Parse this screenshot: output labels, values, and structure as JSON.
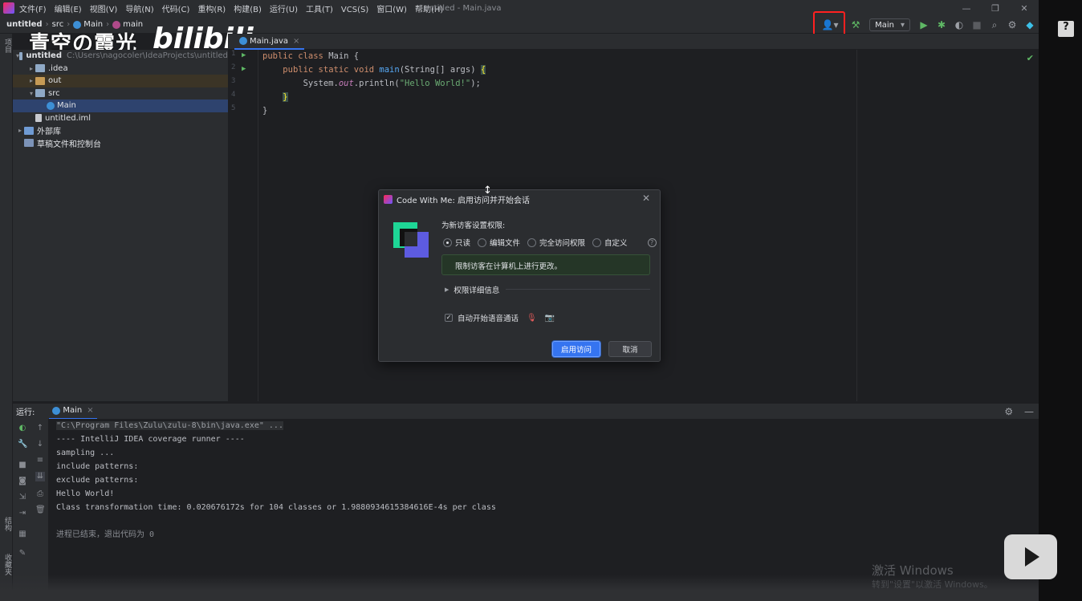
{
  "titlebar": {
    "menus": [
      "文件(F)",
      "编辑(E)",
      "视图(V)",
      "导航(N)",
      "代码(C)",
      "重构(R)",
      "构建(B)",
      "运行(U)",
      "工具(T)",
      "VCS(S)",
      "窗口(W)",
      "帮助(H)"
    ],
    "window_title": "untitled - Main.java",
    "controls": [
      "—",
      "❐",
      "✕"
    ]
  },
  "navbar": {
    "project": "untitled",
    "crumb_src": "src",
    "crumb_class": "Main",
    "crumb_method": "main",
    "run_config": "Main"
  },
  "watermark": {
    "text": "青空の霞光",
    "brand": "bilibili"
  },
  "left_strip": {
    "project_label": "项目",
    "structure_label": "结构",
    "bookmarks_label": "收藏夹"
  },
  "project_tree": [
    {
      "label": "untitled",
      "path": "C:\\Users\\nagocoler\\IdeaProjects\\untitled",
      "indent": 0,
      "arrow": "▾",
      "icon": "folder"
    },
    {
      "label": ".idea",
      "indent": 1,
      "arrow": "▸",
      "icon": "folder"
    },
    {
      "label": "out",
      "indent": 1,
      "arrow": "▸",
      "icon": "folder-orange"
    },
    {
      "label": "src",
      "indent": 1,
      "arrow": "▾",
      "icon": "folder"
    },
    {
      "label": "Main",
      "indent": 2,
      "arrow": "",
      "icon": "class"
    },
    {
      "label": "untitled.iml",
      "indent": 1,
      "arrow": "",
      "icon": "file"
    },
    {
      "label": "外部库",
      "indent": 0,
      "arrow": "▸",
      "icon": "library"
    },
    {
      "label": "草稿文件和控制台",
      "indent": 0,
      "arrow": "",
      "icon": "scratch"
    }
  ],
  "editor": {
    "tab": "Main.java",
    "line_numbers": [
      "1",
      "2",
      "3",
      "4",
      "5"
    ],
    "lines": [
      [
        [
          "kw",
          "public class "
        ],
        [
          "",
          "Main {"
        ]
      ],
      [
        [
          "",
          "    "
        ],
        [
          "kw",
          "public static void "
        ],
        [
          "fn",
          "main"
        ],
        [
          "",
          "(String[] args) "
        ],
        [
          "brace",
          "{"
        ]
      ],
      [
        [
          "",
          "        System."
        ],
        [
          "it",
          "out"
        ],
        [
          "",
          ".println("
        ],
        [
          "st",
          "\"Hello World!\""
        ],
        [
          "",
          ");"
        ]
      ],
      [
        [
          "",
          "    "
        ],
        [
          "brace",
          "}"
        ]
      ],
      [
        [
          "",
          "}"
        ]
      ]
    ]
  },
  "run_panel": {
    "label": "运行:",
    "tab": "Main",
    "console": [
      {
        "text": "\"C:\\Program Files\\Zulu\\zulu-8\\bin\\java.exe\" ...",
        "style": "cmd"
      },
      {
        "text": "---- IntelliJ IDEA coverage runner ----",
        "style": ""
      },
      {
        "text": "sampling ...",
        "style": ""
      },
      {
        "text": "include patterns:",
        "style": ""
      },
      {
        "text": "exclude patterns:",
        "style": ""
      },
      {
        "text": "Hello World!",
        "style": ""
      },
      {
        "text": "Class transformation time: 0.020676172s for 104 classes or 1.9880934615384616E-4s per class",
        "style": ""
      },
      {
        "text": "",
        "style": ""
      },
      {
        "text": "进程已结束，退出代码为 0",
        "style": "gray"
      }
    ]
  },
  "dialog": {
    "title": "Code With Me: 启用访问并开始会话",
    "permission_title": "为新访客设置权限:",
    "radios": [
      {
        "label": "只读",
        "checked": true
      },
      {
        "label": "编辑文件",
        "checked": false
      },
      {
        "label": "完全访问权限",
        "checked": false
      },
      {
        "label": "自定义",
        "checked": false
      }
    ],
    "info": "限制访客在计算机上进行更改。",
    "details": "权限详细信息",
    "voice_checkbox": "自动开始语音通话",
    "primary_button": "启用访问",
    "cancel_button": "取消"
  },
  "overlay": {
    "help": "?",
    "activate_line1": "激活 Windows",
    "activate_line2": "转到\"设置\"以激活 Windows。"
  },
  "colors": {
    "accent": "#3574f0",
    "highlight_box": "#ff2020",
    "run_green": "#5fb865"
  }
}
